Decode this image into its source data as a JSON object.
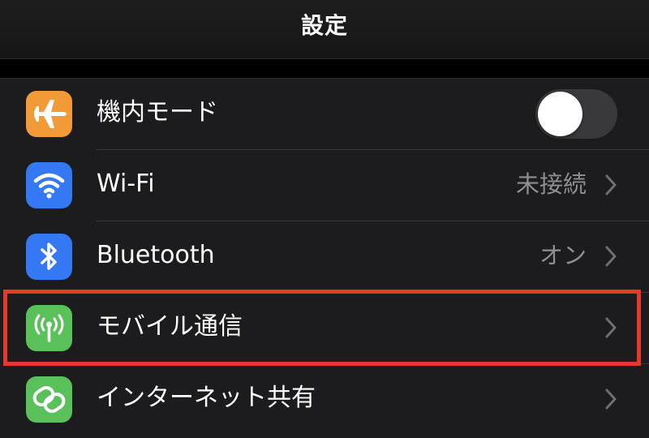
{
  "nav": {
    "title": "設定"
  },
  "rows": [
    {
      "label": "機内モード",
      "icon": "airplane-icon",
      "icon_color": "#f19a37",
      "toggle_on": false
    },
    {
      "label": "Wi-Fi",
      "icon": "wifi-icon",
      "icon_color": "#3478f6",
      "value": "未接続"
    },
    {
      "label": "Bluetooth",
      "icon": "bluetooth-icon",
      "icon_color": "#3478f6",
      "value": "オン"
    },
    {
      "label": "モバイル通信",
      "icon": "antenna-icon",
      "icon_color": "#5ac05a",
      "highlighted": true
    },
    {
      "label": "インターネット共有",
      "icon": "chain-link-icon",
      "icon_color": "#5ac05a"
    }
  ],
  "colors": {
    "background": "#000000",
    "group_background": "#1c1c1e",
    "highlight": "#e53a2a",
    "secondary_text": "#8e8e93",
    "toggle_off": "#39393d"
  }
}
